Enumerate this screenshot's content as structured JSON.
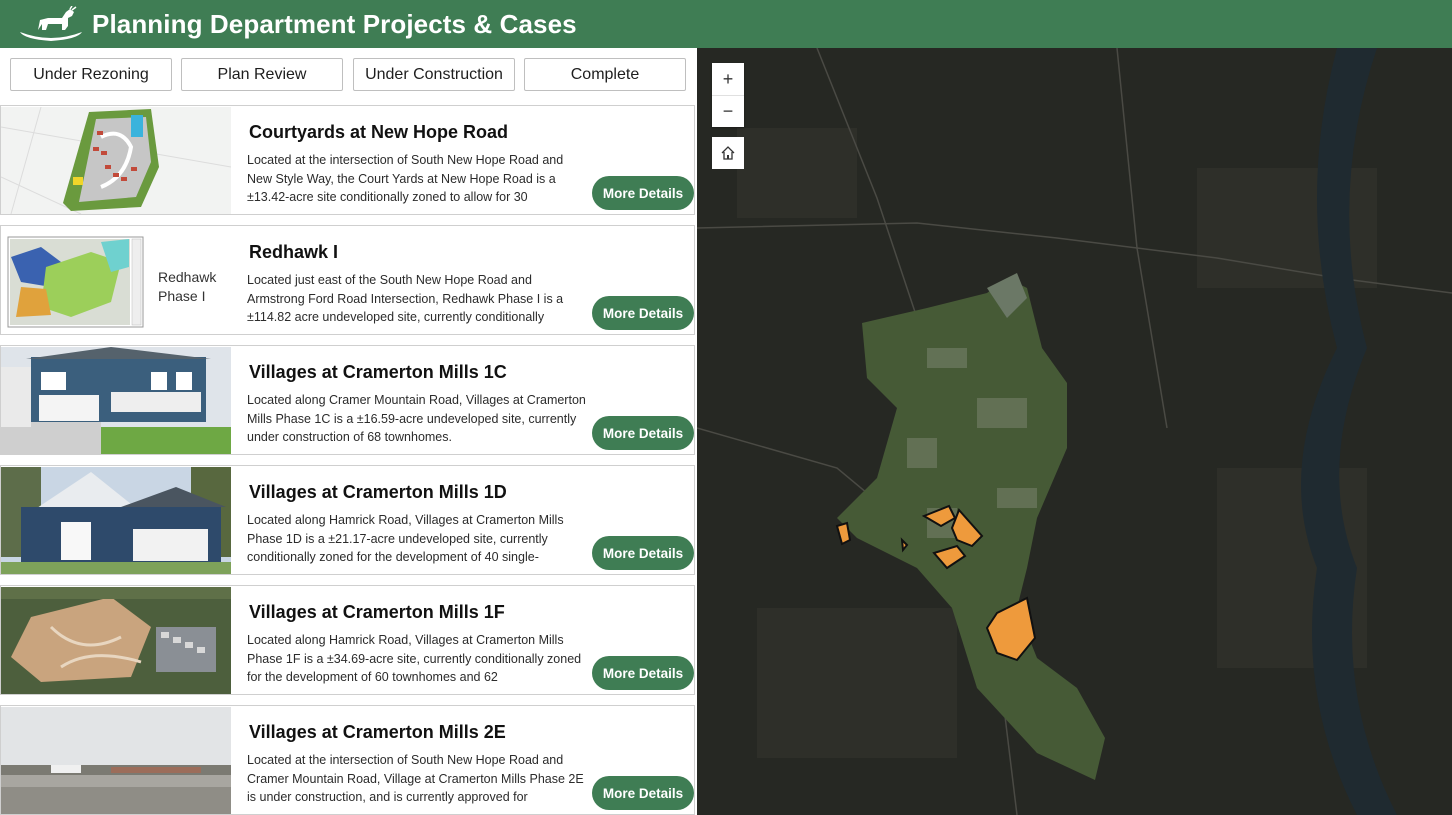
{
  "header": {
    "title": "Planning Department Projects & Cases"
  },
  "filters": [
    {
      "label": "Under Rezoning"
    },
    {
      "label": "Plan Review"
    },
    {
      "label": "Under Construction"
    },
    {
      "label": "Complete"
    }
  ],
  "cards": [
    {
      "title": "Courtyards at New Hope Road",
      "description": "Located at the intersection of South New Hope Road and New Style Way, the Court Yards at New Hope Road is a ±13.42-acre site conditionally zoned to allow for 30",
      "button": "More Details"
    },
    {
      "title": "Redhawk I",
      "description": "Located just east of the South New Hope Road and Armstrong Ford Road Intersection, Redhawk Phase I is a ±114.82 acre undeveloped site, currently conditionally",
      "button": "More Details",
      "thumb_text": [
        "Redhawk",
        "Phase I"
      ]
    },
    {
      "title": "Villages at Cramerton Mills 1C",
      "description": "Located along Cramer Mountain Road, Villages at Cramerton Mills Phase 1C is a ±16.59-acre undeveloped site, currently under construction of 68 townhomes.",
      "button": "More Details"
    },
    {
      "title": "Villages at Cramerton Mills 1D",
      "description": "Located along Hamrick Road, Villages at Cramerton Mills Phase 1D is a ±21.17-acre undeveloped site, currently conditionally zoned for the development of 40 single-",
      "button": "More Details"
    },
    {
      "title": "Villages at Cramerton Mills 1F",
      "description": "Located along Hamrick Road, Villages at Cramerton Mills Phase 1F is a ±34.69-acre site, currently conditionally zoned for the development of 60 townhomes and 62",
      "button": "More Details"
    },
    {
      "title": "Villages at Cramerton Mills 2E",
      "description": "Located at the intersection of South New Hope Road and Cramer Mountain Road, Village at Cramerton Mills Phase 2E is under construction, and is currently approved for",
      "button": "More Details"
    }
  ],
  "map": {
    "zoom_in": "+",
    "zoom_out": "−"
  },
  "colors": {
    "brand_green": "#3f7d54",
    "parcel_orange": "#ee9a3c"
  }
}
